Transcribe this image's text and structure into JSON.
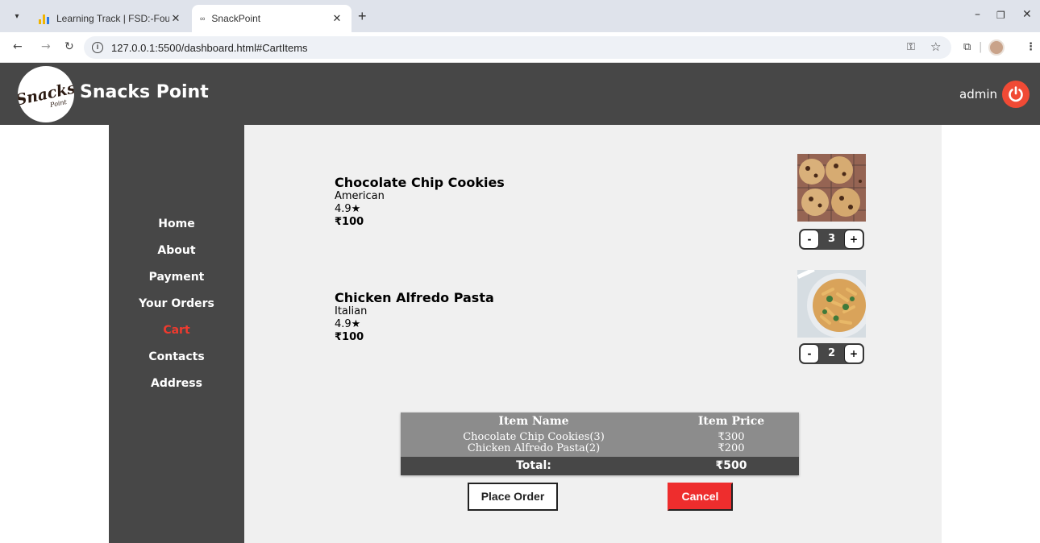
{
  "browser": {
    "tabs": [
      {
        "title": "Learning Track | FSD:-Foundatio",
        "active": false
      },
      {
        "title": "SnackPoint",
        "active": true
      }
    ],
    "url": "127.0.0.1:5500/dashboard.html#CartItems"
  },
  "header": {
    "logo_text": "Snacks",
    "logo_sub": "Point",
    "brand": "Snacks Point",
    "username": "admin",
    "accent_color": "#f04a35"
  },
  "sidebar": {
    "items": [
      {
        "label": "Home",
        "active": false
      },
      {
        "label": "About",
        "active": false
      },
      {
        "label": "Payment",
        "active": false
      },
      {
        "label": "Your Orders",
        "active": false
      },
      {
        "label": "Cart",
        "active": true
      },
      {
        "label": "Contacts",
        "active": false
      },
      {
        "label": "Address",
        "active": false
      }
    ]
  },
  "cart": {
    "items": [
      {
        "name": "Chocolate Chip Cookies",
        "cuisine": "American",
        "rating": "4.9★",
        "price": "₹100",
        "quantity": "3",
        "minus": "-",
        "plus": "+"
      },
      {
        "name": "Chicken Alfredo Pasta",
        "cuisine": "Italian",
        "rating": "4.9★",
        "price": "₹100",
        "quantity": "2",
        "minus": "-",
        "plus": "+"
      }
    ]
  },
  "summary": {
    "col_name": "Item Name",
    "col_price": "Item Price",
    "rows": [
      {
        "name": "Chocolate Chip Cookies(3)",
        "price": "₹300"
      },
      {
        "name": "Chicken Alfredo Pasta(2)",
        "price": "₹200"
      }
    ],
    "total_label": "Total:",
    "total_value": "₹500"
  },
  "actions": {
    "place_order": "Place Order",
    "cancel": "Cancel"
  }
}
